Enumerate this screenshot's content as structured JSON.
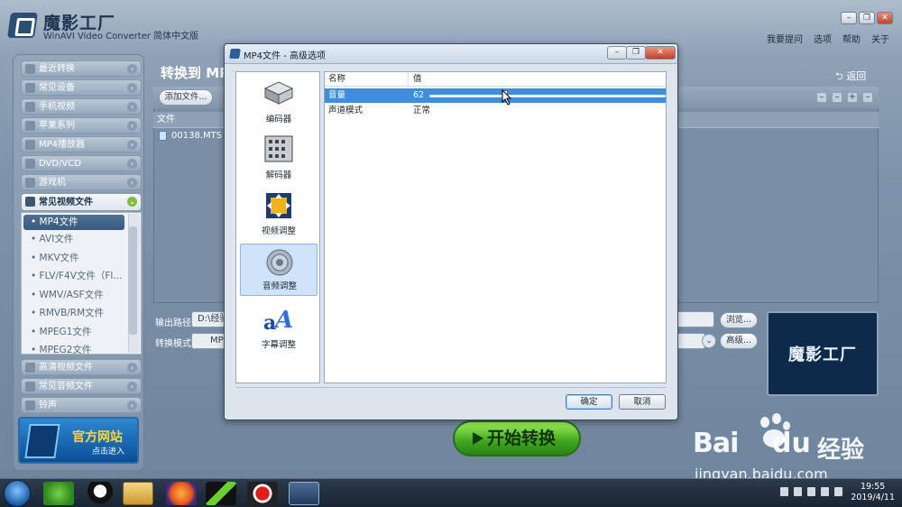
{
  "app": {
    "title": "魔影工厂",
    "subtitle": "WinAVI Video Converter 简体中文版",
    "window_controls": [
      "–",
      "❐",
      "✕"
    ],
    "menu": [
      "我要提问",
      "选项",
      "帮助",
      "关于"
    ]
  },
  "sidebar": {
    "categories": [
      {
        "label": "最近转换",
        "icon": "clock-icon"
      },
      {
        "label": "常见设备",
        "icon": "device-icon"
      },
      {
        "label": "手机视频",
        "icon": "phone-icon"
      },
      {
        "label": "苹果系列",
        "icon": "apple-icon"
      },
      {
        "label": "MP4播放器",
        "icon": "player-icon"
      },
      {
        "label": "DVD/VCD",
        "icon": "disc-icon"
      },
      {
        "label": "游戏机",
        "icon": "gamepad-icon"
      },
      {
        "label": "常见视频文件",
        "icon": "film-icon",
        "open": true
      }
    ],
    "subitems": [
      "• MP4文件",
      "• AVI文件",
      "• MKV文件",
      "• FLV/F4V文件（Fl...",
      "• WMV/ASF文件",
      "• RMVB/RM文件",
      "• MPEG1文件",
      "• MPEG2文件"
    ],
    "selected_subitem": "• MP4文件",
    "bottom_categories": [
      {
        "label": "高清视频文件",
        "icon": "hd-icon"
      },
      {
        "label": "常见音频文件",
        "icon": "music-icon"
      },
      {
        "label": "铃声",
        "icon": "bell-icon"
      }
    ],
    "banner": {
      "title": "官方网站",
      "subtitle": "点击进入"
    }
  },
  "main": {
    "title": "转换到 MP",
    "back_label": "返回",
    "add_file_label": "添加文件...",
    "file_column": "文件",
    "files": [
      "00138.MTS"
    ],
    "output_path_label": "输出路径:",
    "output_path_value": "D:\\经验",
    "mode_label": "转换模式:",
    "mode_value": "MP",
    "browse_label": "浏览...",
    "advanced_label": "高级...",
    "preview_text": "魔影工厂",
    "start_label": "开始转换"
  },
  "dialog": {
    "title": "MP4文件 - 高级选项",
    "categories": [
      {
        "label": "编码器",
        "icon": "encoder-icon"
      },
      {
        "label": "解码器",
        "icon": "decoder-icon"
      },
      {
        "label": "视频调整",
        "icon": "video-adjust-icon"
      },
      {
        "label": "音频调整",
        "icon": "audio-adjust-icon",
        "selected": true
      },
      {
        "label": "字幕调整",
        "icon": "subtitle-icon"
      }
    ],
    "columns": {
      "name": "名称",
      "value": "值"
    },
    "rows": [
      {
        "name": "音量",
        "value": "62",
        "selected": true
      },
      {
        "name": "声道模式",
        "value": "正常"
      }
    ],
    "volume_level": 0.62,
    "ok_label": "确定",
    "cancel_label": "取消"
  },
  "taskbar": {
    "time": "19:55",
    "date": "2019/4/11"
  },
  "watermark": {
    "brand": "Bai",
    "brand2": "du",
    "suffix": "经验",
    "url": "jingyan.baidu.com"
  },
  "colors": {
    "selection_blue": "#3d8fde",
    "start_green": "#3ea51f",
    "sidebar_selected": "#3a5b7e"
  }
}
